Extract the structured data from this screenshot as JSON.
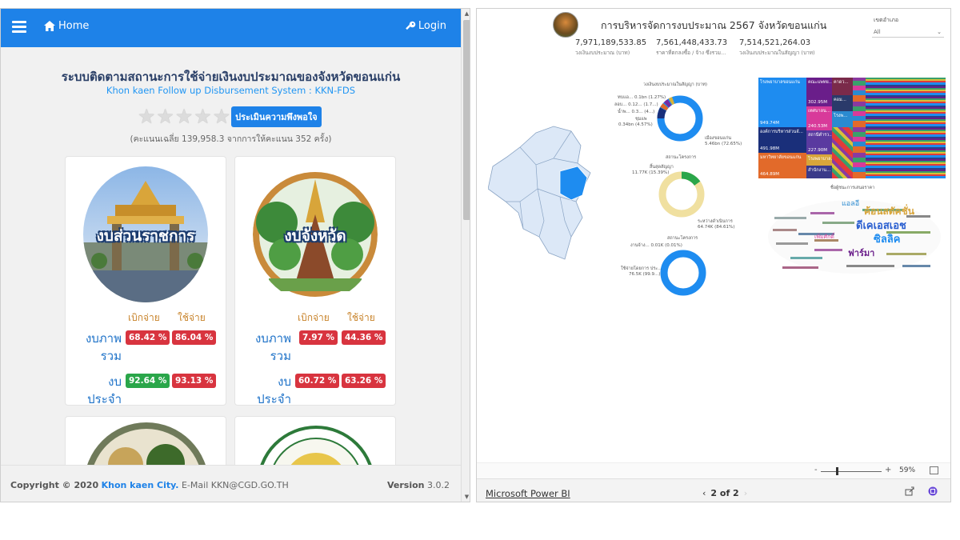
{
  "nav": {
    "home": "Home",
    "login": "Login"
  },
  "header": {
    "title_th": "ระบบติดตามสถานะการใช้จ่ายเงินงบประมาณของจังหวัดขอนแก่น",
    "title_en": "Khon kaen Follow up Disbursement System : KKN-FDS"
  },
  "rating": {
    "stars": 5,
    "button": "ประเมินความพึงพอใจ",
    "score_text": "(คะแนนเฉลี่ย 139,958.3 จากการให้คะแนน 352 ครั้ง)"
  },
  "cards": [
    {
      "label": "งบส่วนราชการ",
      "col_withdraw": "เบิกจ่าย",
      "col_spend": "ใช้จ่าย",
      "rows": [
        {
          "name": "งบภาพ รวม",
          "withdraw": "68.42 %",
          "spend": "86.04 %",
          "withdraw_color": "#d8343f",
          "spend_color": "#d8343f"
        },
        {
          "name": "งบ ประจำ",
          "withdraw": "92.64 %",
          "spend": "93.13 %",
          "withdraw_color": "#2aa64a",
          "spend_color": "#d8343f"
        }
      ]
    },
    {
      "label": "งบจังหวัด",
      "col_withdraw": "เบิกจ่าย",
      "col_spend": "ใช้จ่าย",
      "rows": [
        {
          "name": "งบภาพ รวม",
          "withdraw": "7.97 %",
          "spend": "44.36 %",
          "withdraw_color": "#d8343f",
          "spend_color": "#d8343f"
        },
        {
          "name": "งบ ประจำ",
          "withdraw": "60.72 %",
          "spend": "63.26 %",
          "withdraw_color": "#d8343f",
          "spend_color": "#d8343f"
        }
      ]
    }
  ],
  "footer": {
    "copyright_prefix": "Copyright © 2020",
    "city": "Khon kaen City.",
    "email": "E-Mail KKN@CGD.GO.TH",
    "version_label": "Version",
    "version": "3.0.2"
  },
  "powerbi": {
    "title": "การบริหารจัดการงบประมาณ 2567 จังหวัดขอนแก่น",
    "slicer_label": "เขตอำเภอ",
    "slicer_value": "All",
    "kpis": [
      {
        "value": "7,971,189,533.85",
        "label": "วงเงินงบประมาณ (บาท)"
      },
      {
        "value": "7,561,448,433.73",
        "label": "ราคาที่ตกลงซื้อ / จ้าง ซึ่งรวม..."
      },
      {
        "value": "7,514,521,264.03",
        "label": "วงเงินงบประมาณในสัญญา (บาท)"
      }
    ],
    "donut1_title": "วงเงินงบประมาณในสัญญา (บาท)",
    "donut1_labels": [
      "ทบแอ... 0.1bn (1.27%)",
      "ลอบ... 0.12... (1.7...)",
      "น้ำพ... 0.3... (4...)",
      "ชุมแพ",
      "0.34bn (4.57%)",
      "เมืองขอนแก่น",
      "5.46bn (72.65%)"
    ],
    "donut2_title": "สถานะโครงการ",
    "donut2_labels": [
      "สิ้นสุดสัญญา",
      "11.77K (15.39%)",
      "ระหว่างดำเนินการ",
      "64.74K (84.61%)"
    ],
    "donut3_title": "สถานะโครงการ",
    "donut3_labels": [
      "งานจ้าง... 0.01K (0.01%)",
      "ใช้จ่ายโดยการ ประ...",
      "76.5K (99.9...)"
    ],
    "treemap_labels": [
      "โรงพยาบาลขอนแก่น",
      "949.74M",
      "องค์การบริหารส่วนจั...",
      "491.98M",
      "มหาวิทยาลัยขอนแก่น",
      "464.89M",
      "คณะแพทย...",
      "302.95M",
      "เทศบาลน...",
      "240.53M",
      "สถานีตำรว...",
      "227.90M",
      "โรงพยาบาล...",
      "สำนักงาน...",
      "คาดว...",
      "คอม...",
      "โรงพ..."
    ],
    "wordcloud_title": "ชื่อผู้ชนะการเสนอราคา",
    "wordcloud_words": [
      "ค้อนสตัคชั่น",
      "ดีเคเอสเอช",
      "ซิลลิค",
      "ฟาร์มา",
      "แอลอี",
      "เพิ่มศักดิ์"
    ],
    "zoom": "59%",
    "brand": "Microsoft Power BI",
    "page": "2 of 2"
  }
}
